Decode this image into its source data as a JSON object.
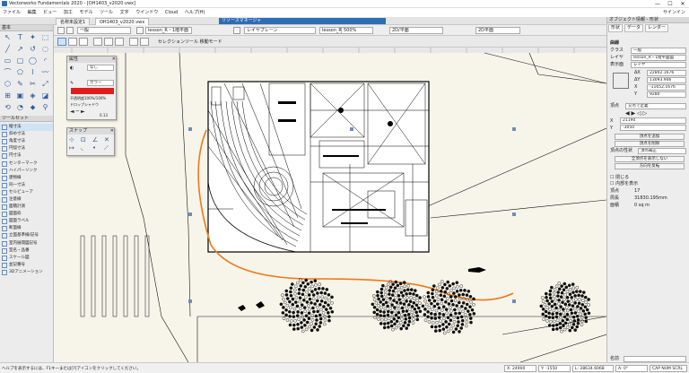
{
  "app": {
    "title": "Vectorworks Fundamentals 2020 - [OH1403_v2020.vwx]",
    "window_controls": [
      "—",
      "☐",
      "✕"
    ]
  },
  "menu": {
    "items": [
      "ファイル",
      "編集",
      "ビュー",
      "加工",
      "モデル",
      "ツール",
      "文字",
      "ウインドウ",
      "Cloud",
      "ヘルプ(H)"
    ],
    "user": "サインイン"
  },
  "tabs": [
    {
      "label": "名称未設定1"
    },
    {
      "label": "OH1403_v2020.vwx"
    }
  ],
  "resource_tab": "リソースマネージャ",
  "view_bar": {
    "view_select": "一般",
    "layer_select": "lesson_R・1階平面図",
    "class_select": "レイヤプレーン",
    "scale_select": "500%",
    "view2_select": "2D/平面",
    "render_select": "2D平面"
  },
  "mode_bar": {
    "label": "セレクションツール 移動モード"
  },
  "basic_palette": {
    "title": "基本",
    "tools": [
      "↖",
      "T",
      "✦",
      "⬚",
      "╱",
      "↗",
      "↺",
      "◌",
      "▭",
      "▢",
      "◯",
      "◜",
      "⌒",
      "⬠",
      "⌇",
      "〰",
      "⬡",
      "✎",
      "✂",
      "⤢",
      "⊞",
      "▣",
      "◈",
      "◪",
      "⟲",
      "◔",
      "⬥",
      "⚲"
    ]
  },
  "toolsets": {
    "title": "ツールセット",
    "items": [
      "縦寸法",
      "斜め寸法",
      "角度寸法",
      "円弧寸法",
      "円寸法",
      "センターマーク",
      "ハイパーリンク",
      "建物線",
      "同一寸法",
      "セルビューア",
      "注意線",
      "面積計測",
      "図面枠",
      "図面ラベル",
      "断面線",
      "立面基準線/記号",
      "室内展開図記号",
      "室名・品番",
      "スケール図",
      "並記番号",
      "3Dアニメーション"
    ]
  },
  "attributes_palette": {
    "title": "属性",
    "fill_label": "なし",
    "pen_label": "カラー",
    "pen_color": "#e21b1b",
    "opacity": "不透明度100%/100%",
    "drop_shadow": "ドロップシャドウ",
    "line_weight": "0.13"
  },
  "snap_palette": {
    "title": "スナップ"
  },
  "oip": {
    "tabs": [
      "形状",
      "データ",
      "レンダー"
    ],
    "object_type": "曲線",
    "class_label": "クラス",
    "class_value": "一般",
    "layer_label": "レイヤ",
    "layer_value": "lesson_R・1階平面図",
    "plane_label": "表示面",
    "plane_value": "レイヤ",
    "dx_label": "ΔX",
    "dx": "22802.1676",
    "dy_label": "ΔY",
    "dy": "13093.946",
    "x_label": "X",
    "x": "-11652.1676",
    "y_label": "Y",
    "y": "9280",
    "vertex_label": "頂点",
    "vertex_mode": "交点で定義",
    "vx_label": "X",
    "vx": "21190",
    "vy_label": "Y",
    "vy": "-3050",
    "btn_add": "頂点を追加",
    "btn_del": "頂点を削除",
    "point_type_label": "頂点の性状",
    "point_type": "頂点補正",
    "btn_show": "全頂点を表示しない",
    "btn_reverse": "方向を反転",
    "chk_closed": "閉じる",
    "chk_fill": "内部を表示",
    "vertices_label": "頂点",
    "vertices": "17",
    "perimeter_label": "周長",
    "perimeter": "31830.195mm",
    "area_label": "面積",
    "area": "0 sq m",
    "name_label": "名前"
  },
  "status": {
    "hint": "ヘルプを表示するには、F1キーまたは[?]アイコンをクリックしてください。",
    "x": "X: 24900",
    "y": "Y: -1550",
    "length": "L: 28634.6068",
    "angle": "A: 0°",
    "grid": "CAP NUM SCRL"
  }
}
